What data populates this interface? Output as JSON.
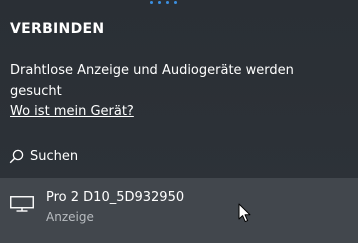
{
  "header": {
    "title": "VERBINDEN"
  },
  "status": {
    "text": "Drahtlose Anzeige und Audiogeräte werden gesucht"
  },
  "help": {
    "link_label": "Wo ist mein Gerät?"
  },
  "search": {
    "label": "Suchen",
    "icon": "search-icon"
  },
  "devices": [
    {
      "name": "Pro 2 D10_5D932950",
      "type": "Anzeige",
      "icon": "monitor-icon"
    }
  ],
  "colors": {
    "background": "#2c3137",
    "selected_row": "#42474d",
    "progress_dots": "#3b8fe0",
    "secondary_text": "#b8bcc0"
  }
}
